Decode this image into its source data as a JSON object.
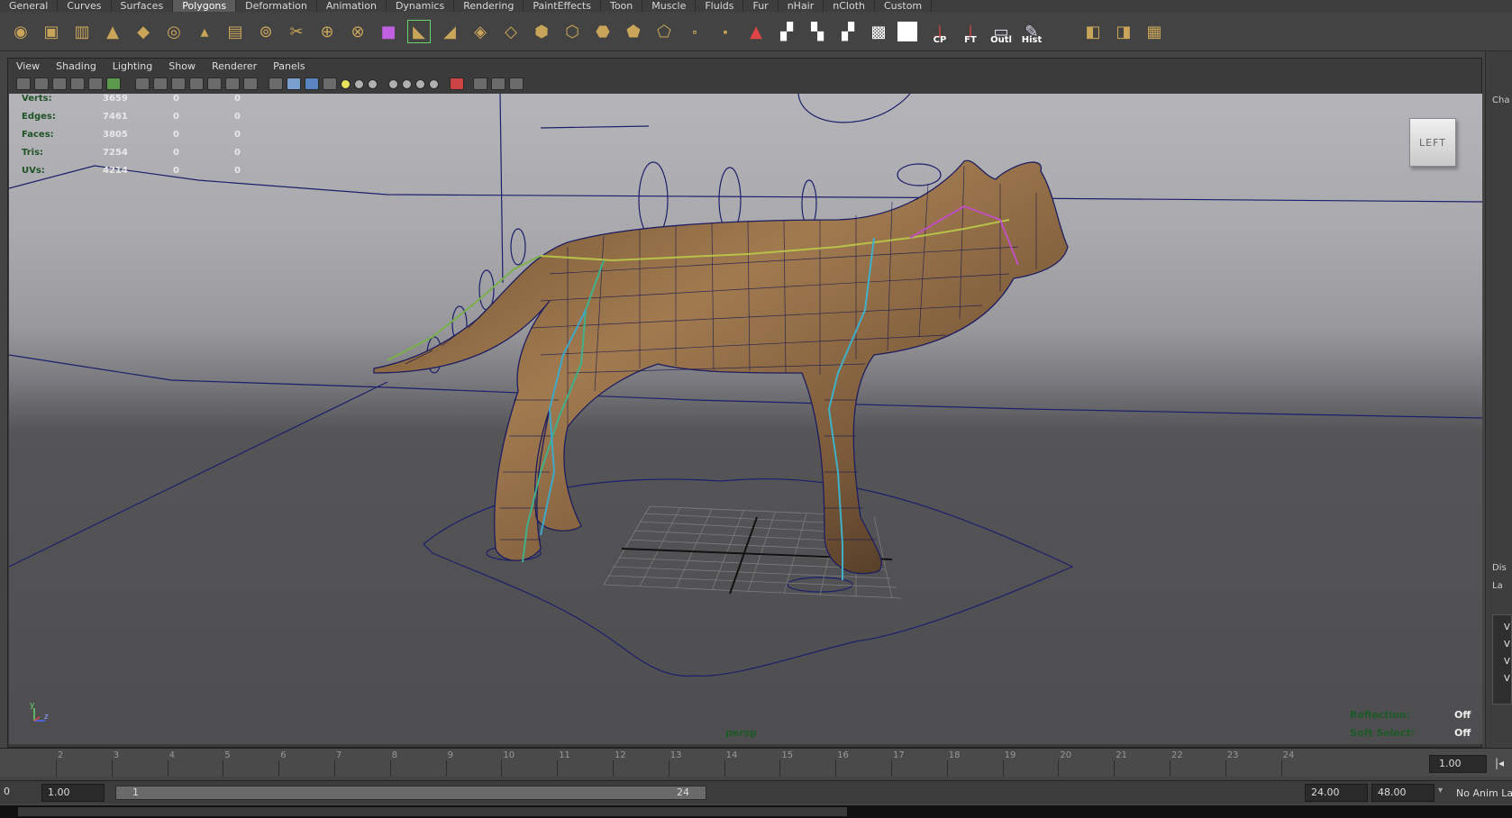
{
  "shelf_tabs": [
    "General",
    "Curves",
    "Surfaces",
    "Polygons",
    "Deformation",
    "Animation",
    "Dynamics",
    "Rendering",
    "PaintEffects",
    "Toon",
    "Muscle",
    "Fluids",
    "Fur",
    "nHair",
    "nCloth",
    "Custom"
  ],
  "active_shelf_tab": "Polygons",
  "shelf_labels": {
    "cp": "CP",
    "ft": "FT",
    "outl": "Outl",
    "hist": "Hist"
  },
  "panel_menu": [
    "View",
    "Shading",
    "Lighting",
    "Show",
    "Renderer",
    "Panels"
  ],
  "hud": {
    "rows": [
      {
        "label": "Verts:",
        "a": "3659",
        "b": "0",
        "c": "0"
      },
      {
        "label": "Edges:",
        "a": "7461",
        "b": "0",
        "c": "0"
      },
      {
        "label": "Faces:",
        "a": "3805",
        "b": "0",
        "c": "0"
      },
      {
        "label": "Tris:",
        "a": "7254",
        "b": "0",
        "c": "0"
      },
      {
        "label": "UVs:",
        "a": "4214",
        "b": "0",
        "c": "0"
      }
    ],
    "reflection_label": "Reflection:",
    "reflection_value": "Off",
    "soft_select_label": "Soft Select:",
    "soft_select_value": "Off",
    "camera": "persp"
  },
  "viewcube_label": "LEFT",
  "axis": {
    "y": "y",
    "z": "z"
  },
  "side_panel": {
    "tab": "Cha",
    "dis": "Dis",
    "lay": "La",
    "v": "V"
  },
  "timeline": {
    "ticks": [
      "2",
      "3",
      "4",
      "5",
      "6",
      "7",
      "8",
      "9",
      "10",
      "11",
      "12",
      "13",
      "14",
      "15",
      "16",
      "17",
      "18",
      "19",
      "20",
      "21",
      "22",
      "23",
      "24"
    ],
    "current_time": "1.00",
    "range_start_left": "0",
    "start_time": "1.00",
    "slider_start": "1",
    "slider_end": "24",
    "end_time": "24.00",
    "playback_end": "48.00",
    "anim_layer": "No Anim Laye"
  }
}
